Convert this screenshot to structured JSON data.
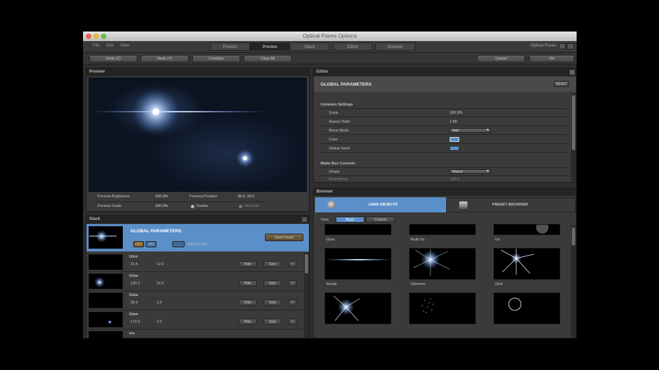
{
  "window": {
    "title": "Optical Flares Options",
    "menu": [
      "File",
      "Edit",
      "View"
    ],
    "tabs": [
      {
        "label": "Presets",
        "active": false
      },
      {
        "label": "Preview",
        "active": true
      },
      {
        "label": "Stack",
        "active": false
      },
      {
        "label": "Editor",
        "active": false
      },
      {
        "label": "Browser",
        "active": false
      }
    ],
    "brand": "Optical Flares"
  },
  "toolbar": {
    "buttons": [
      "Undo (Z)",
      "Redo (Y)",
      "Combine",
      "Clear All",
      "Cancel",
      "OK"
    ]
  },
  "preview": {
    "header": "Preview",
    "brightness_label": "Preview Brightness",
    "brightness_value": "100.0%",
    "position_label": "Preview Position",
    "position_value": "35.0, 33.0",
    "scale_label": "Preview Scale",
    "scale_value": "100.0%",
    "guides_label": "Guides",
    "show_all_label": "Show All"
  },
  "stack": {
    "header": "Stack",
    "global": {
      "title": "GLOBAL PARAMETERS",
      "toggle_off": "OFF",
      "toggle_on": "ON",
      "blend_label": "Blend Color",
      "save_button": "Save Preset"
    },
    "items": [
      {
        "name": "Glint",
        "v1": "15.5",
        "v2": "12.0",
        "hide": "Hide",
        "solo": "Solo"
      },
      {
        "name": "Glow",
        "v1": "130.0",
        "v2": "16.0",
        "hide": "Hide",
        "solo": "Solo"
      },
      {
        "name": "Glow",
        "v1": "30.0",
        "v2": "2.0",
        "hide": "Hide",
        "solo": "Solo"
      },
      {
        "name": "Glow",
        "v1": "172.0",
        "v2": "2.0",
        "hide": "Hide",
        "solo": "Solo"
      },
      {
        "name": "Iris",
        "v1": "",
        "v2": "",
        "hide": "",
        "solo": ""
      }
    ]
  },
  "editor": {
    "header": "Editor",
    "title": "GLOBAL PARAMETERS",
    "reset": "RESET",
    "section1": "Common Settings",
    "rows": [
      {
        "label": "Scale",
        "value": "100.0%"
      },
      {
        "label": "Aspect Ratio",
        "value": "1.00"
      },
      {
        "label": "Blend Mode",
        "value": "Add"
      },
      {
        "label": "Color",
        "value": ""
      },
      {
        "label": "Global Seed",
        "value": ""
      }
    ],
    "section2": "Matte Box Controls",
    "rows2": [
      {
        "label": "Shape",
        "value": "Round"
      },
      {
        "label": "Roundness",
        "value": "100.0"
      }
    ]
  },
  "browser": {
    "header": "Browser",
    "tab_lens": "LENS OBJECTS",
    "tab_preset": "PRESET BROWSER",
    "view_label": "View",
    "view_basic": "Basic",
    "view_custom": "Custom",
    "row1_labels": [
      "Glow",
      "Multi Iris",
      "Iris"
    ],
    "row2_labels": [
      "Streak",
      "Shimmer",
      "Glint"
    ],
    "row3_labels": [
      "",
      "",
      ""
    ]
  },
  "colors": {
    "accent": "#5b8fc9",
    "panel": "#3a3a3a",
    "header": "#242424"
  }
}
